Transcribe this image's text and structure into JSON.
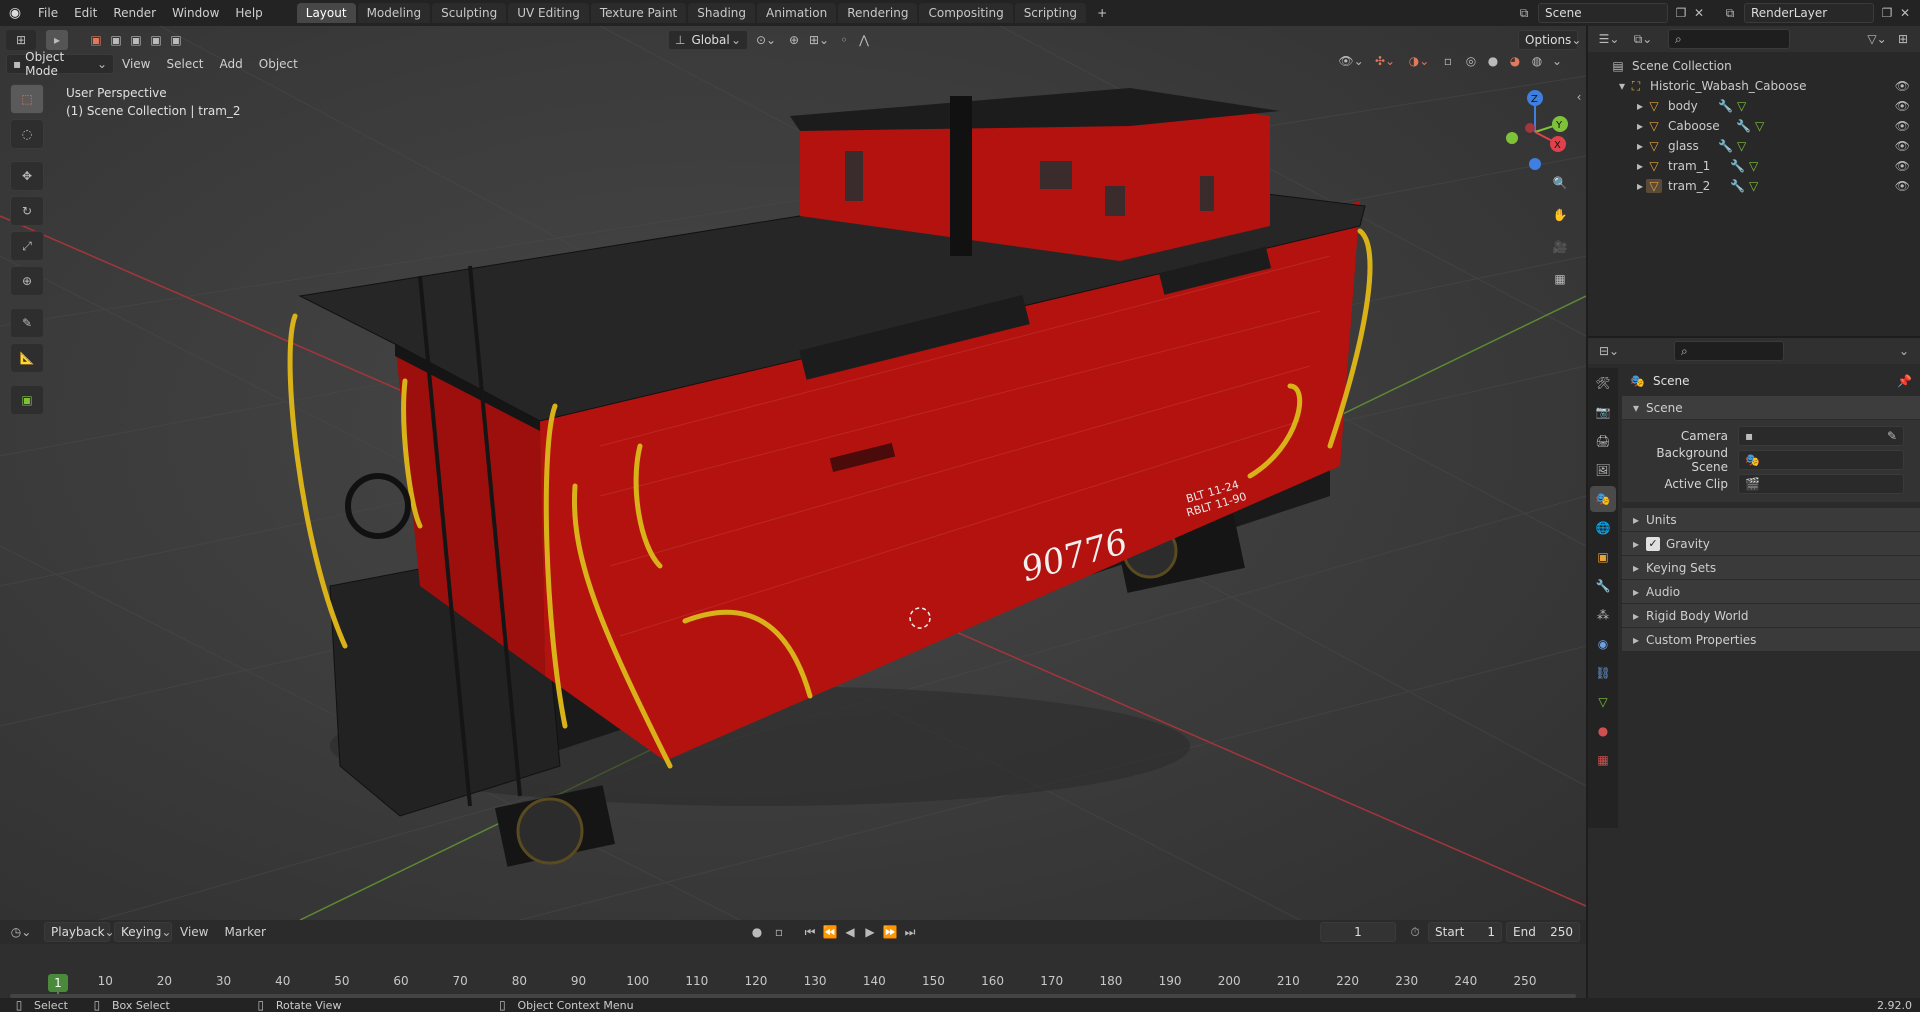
{
  "topbar": {
    "menus": [
      "File",
      "Edit",
      "Render",
      "Window",
      "Help"
    ],
    "workspaces": [
      "Layout",
      "Modeling",
      "Sculpting",
      "UV Editing",
      "Texture Paint",
      "Shading",
      "Animation",
      "Rendering",
      "Compositing",
      "Scripting"
    ],
    "active_workspace": "Layout",
    "add_tab": "+",
    "scene_name": "Scene",
    "view_layer": "RenderLayer"
  },
  "viewport_header": {
    "mode": "Object Mode",
    "menus": [
      "View",
      "Select",
      "Add",
      "Object"
    ],
    "transform_orientation": "Global",
    "options_label": "Options"
  },
  "viewport": {
    "perspective_label": "User Perspective",
    "collection_label": "(1) Scene Collection | tram_2",
    "caboose_number": "90776",
    "caboose_stencil_1": "BLT 11-24",
    "caboose_stencil_2": "RBLT 11-90",
    "gizmo_axes": [
      "Z",
      "Y",
      "X"
    ],
    "colors": {
      "caboose_red": "#b4120f",
      "rail_yellow": "#d9b21a",
      "x_axis": "#e0414a",
      "y_axis": "#7fc23a",
      "z_axis": "#3f7fe0"
    }
  },
  "outliner": {
    "root": "Scene Collection",
    "collection": "Historic_Wabash_Caboose",
    "objects": [
      "body",
      "Caboose",
      "glass",
      "tram_1",
      "tram_2"
    ]
  },
  "properties": {
    "context_label": "Scene",
    "panel_title": "Scene",
    "fields": {
      "camera": "Camera",
      "background_scene": "Background Scene",
      "active_clip": "Active Clip"
    },
    "subpanels": [
      "Units",
      "Gravity",
      "Keying Sets",
      "Audio",
      "Rigid Body World",
      "Custom Properties"
    ],
    "gravity_enabled": true
  },
  "timeline": {
    "menus": [
      "Playback",
      "Keying",
      "View",
      "Marker"
    ],
    "current_frame": "1",
    "start_label": "Start",
    "start_value": "1",
    "end_label": "End",
    "end_value": "250",
    "ruler": [
      "10",
      "20",
      "30",
      "40",
      "50",
      "60",
      "70",
      "80",
      "90",
      "100",
      "110",
      "120",
      "130",
      "140",
      "150",
      "160",
      "170",
      "180",
      "190",
      "200",
      "210",
      "220",
      "230",
      "240",
      "250"
    ],
    "playhead": "1"
  },
  "statusbar": {
    "select": "Select",
    "box_select": "Box Select",
    "rotate_view": "Rotate View",
    "context_menu": "Object Context Menu",
    "version": "2.92.0"
  }
}
